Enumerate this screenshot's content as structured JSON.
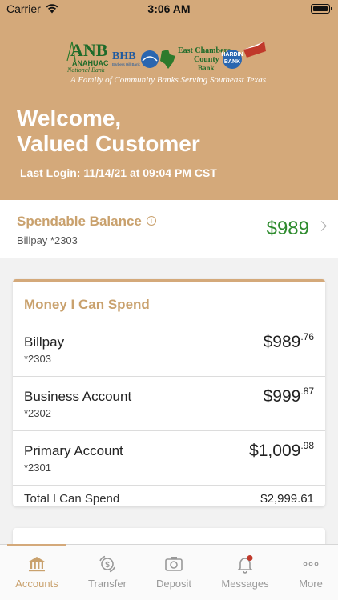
{
  "status_bar": {
    "carrier": "Carrier",
    "time": "3:06 AM"
  },
  "header": {
    "logo_texts": [
      "ANB",
      "ANAHUAC",
      "National Bank",
      "BHB",
      "Barbers Hill Bank",
      "East Chambers",
      "County",
      "Bank",
      "HARDIN",
      "BANK"
    ],
    "tagline": "A Family of Community Banks Serving Southeast Texas",
    "welcome_line1": "Welcome,",
    "welcome_line2": "Valued Customer",
    "last_login": "Last Login: 11/14/21 at 09:04 PM CST"
  },
  "spendable": {
    "title": "Spendable Balance",
    "account": "Billpay *2303",
    "amount": "$989"
  },
  "money_card": {
    "title": "Money I Can Spend",
    "accounts": [
      {
        "name": "Billpay",
        "number": "*2303",
        "dollars": "$989",
        "cents": ".76"
      },
      {
        "name": "Business Account",
        "number": "*2302",
        "dollars": "$999",
        "cents": ".87"
      },
      {
        "name": "Primary Account",
        "number": "*2301",
        "dollars": "$1,009",
        "cents": ".98"
      }
    ],
    "total_label": "Total I Can Spend",
    "total_value": "$2,999.61"
  },
  "tabs": [
    {
      "label": "Accounts",
      "icon": "bank-icon",
      "active": true
    },
    {
      "label": "Transfer",
      "icon": "transfer-icon",
      "active": false
    },
    {
      "label": "Deposit",
      "icon": "camera-icon",
      "active": false
    },
    {
      "label": "Messages",
      "icon": "bell-icon",
      "active": false
    },
    {
      "label": "More",
      "icon": "more-icon",
      "active": false
    }
  ],
  "colors": {
    "brand": "#d4a97a",
    "brand_text": "#c9a16d",
    "positive": "#2e8b2e",
    "notification": "#c0392b"
  }
}
